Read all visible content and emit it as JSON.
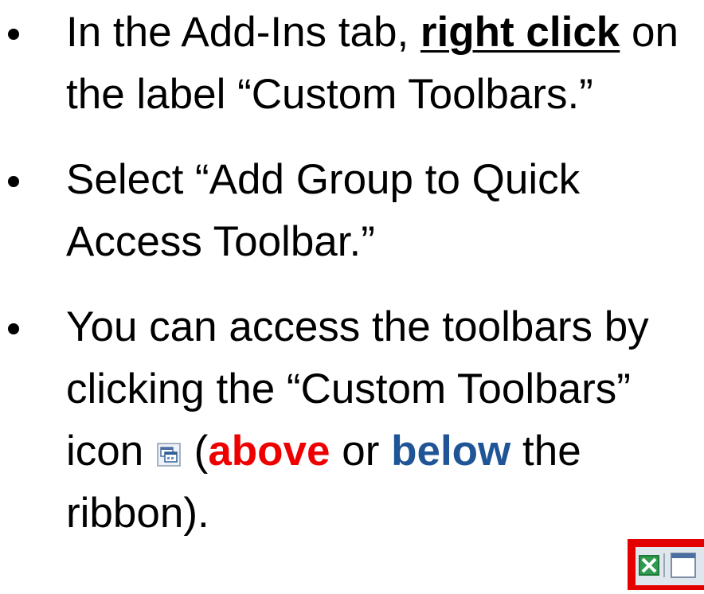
{
  "bullets": [
    {
      "before": "In the Add-Ins tab, ",
      "strong": "right click",
      "after": " on the label “Custom Toolbars.”"
    },
    {
      "text": "Select “Add Group to Quick Access Toolbar.”"
    },
    {
      "part1": "You can access the toolbars by clicking the “Custom Toolbars” icon ",
      "part2": " (",
      "above": "above",
      "part3": " or ",
      "below": "below",
      "part4": " the ribbon)."
    }
  ],
  "icons": {
    "inline": "custom-toolbars-icon",
    "thumbnail": "excel-quick-access-toolbar-icon"
  },
  "colors": {
    "above": "#ee0000",
    "below": "#1f5597",
    "highlight_frame": "#e50000"
  }
}
